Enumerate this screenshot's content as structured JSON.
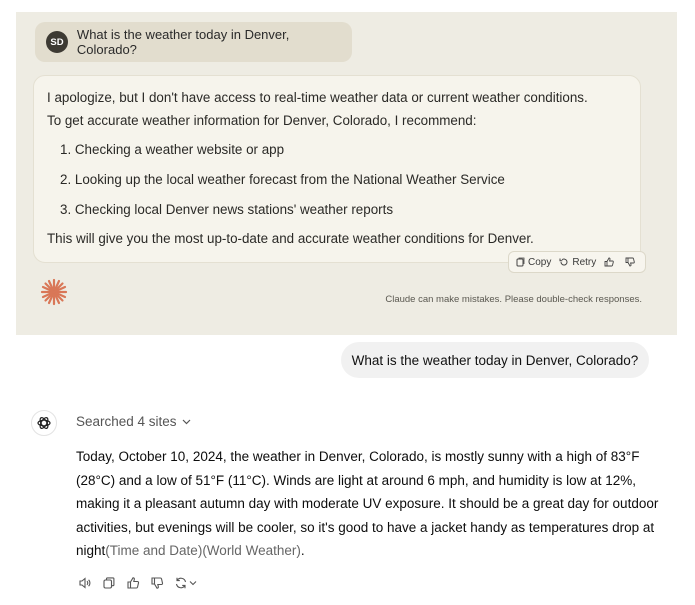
{
  "claude": {
    "avatar_initials": "SD",
    "user_question": "What is the weather today in Denver, Colorado?",
    "answer_lines": [
      "I apologize, but I don't have access to real-time weather data or current weather conditions.",
      "To get accurate weather information for Denver, Colorado, I recommend:",
      "1. Checking a weather website or app",
      "2. Looking up the local weather forecast from the National Weather Service",
      "3. Checking local Denver news stations' weather reports",
      "This will give you the most up-to-date and accurate weather conditions for Denver."
    ],
    "actions": {
      "copy": "Copy",
      "retry": "Retry"
    },
    "disclaimer": "Claude can make mistakes. Please double-check responses.",
    "accent_color": "#d97757"
  },
  "chatgpt": {
    "user_question": "What is the weather today in Denver, Colorado?",
    "searched_label": "Searched 4 sites",
    "answer_lines": [
      "Today, October 10, 2024, the weather in Denver, Colorado, is mostly sunny with a high of 83°F",
      "(28°C) and a low of 51°F (11°C). Winds are light at around 6 mph, and humidity is low at 12%,",
      "making it a pleasant autumn day with moderate UV exposure. It should be a great day for outdoor",
      "activities, but evenings will be cooler, so it's good to have a jacket handy as temperatures drop at"
    ],
    "last_line_text": "night",
    "citation_1": "(Time and Date)",
    "citation_2": "(World Weather)",
    "last_line_end": ".",
    "action_icons": [
      "speaker-icon",
      "copy-icon",
      "thumbs-up-icon",
      "thumbs-down-icon",
      "regenerate-icon"
    ]
  }
}
